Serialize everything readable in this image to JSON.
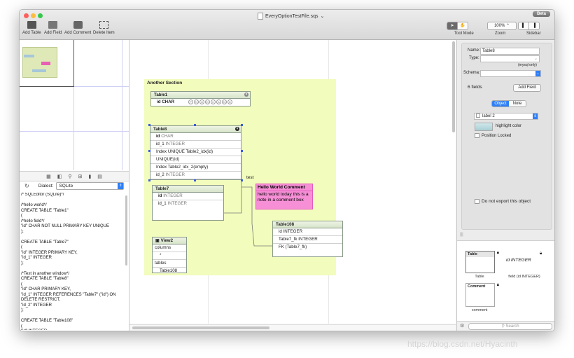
{
  "window": {
    "title": "EveryOptionTestFile.sqs",
    "beta_badge": "Beta"
  },
  "toolbar": {
    "add_table": "Add Table",
    "add_field": "Add Field",
    "add_comment": "Add Comment",
    "delete_item": "Delete Item",
    "tool_mode_label": "Tool Mode",
    "zoom_value": "100%",
    "zoom_label": "Zoom",
    "sidebar_label": "Sidebar"
  },
  "left_panel": {
    "dialect_label": "Dialect:",
    "dialect_value": "SQLite",
    "sql_text": "/* SQLEditor (SQLite)*/\n\n/*hello world*/\nCREATE TABLE \"Table1\"\n(\n/*hello field*/\n\"id\" CHAR NOT NULL PRIMARY KEY UNIQUE\n);\n\nCREATE TABLE \"Table7\"\n(\n\"id\" INTEGER PRIMARY KEY,\n\"id_1\" INTEGER\n);\n\n/*Text in another window*/\nCREATE TABLE \"Table8\"\n(\n\"id\" CHAR PRIMARY KEY,\n\"id_1\" INTEGER REFERENCES \"Table7\" (\"id\") ON\nDELETE RESTRICT,\n\"id_2\" INTEGER\n);\n\nCREATE TABLE \"Table108\"\n(\n\"id\" INTEGER,"
  },
  "canvas": {
    "section_title": "Another Section",
    "table1": {
      "name": "Table1",
      "rows": [
        "id CHAR"
      ],
      "badges": [
        "P",
        "N",
        "U",
        "D",
        "C",
        "A",
        "N",
        "D"
      ]
    },
    "table8": {
      "name": "Table8",
      "rows": [
        {
          "bold": "id",
          "type": "CHAR"
        },
        {
          "bold": "id_1",
          "type": "INTEGER"
        },
        {
          "bold": "",
          "type": "Index UNIQUE Table2_idx(id)"
        },
        {
          "bold": "",
          "type": "UNIQUE(id)"
        },
        {
          "bold": "",
          "type": "Index Table2_idx_2(empty)"
        },
        {
          "bold": "id_2",
          "type": "INTEGER"
        }
      ]
    },
    "table7": {
      "name": "Table7",
      "rows": [
        {
          "bold": "id",
          "type": "INTEGER"
        },
        {
          "bold": "id_1",
          "type": "INTEGER"
        }
      ]
    },
    "table108": {
      "name": "Table108",
      "rows": [
        "id INTEGER",
        "Table7_fk INTEGER",
        "FK (Table7_fk)"
      ]
    },
    "relation_label": "test",
    "note": {
      "title": "Hello World Comment",
      "body": "hello world  today this is a note in a comment box"
    },
    "view2": {
      "name": "View2",
      "rows": [
        "columns",
        "*",
        "tables",
        "Table108"
      ]
    }
  },
  "inspector": {
    "name_label": "Name:",
    "name_value": "Table8",
    "type_label": "Type:",
    "mysql_only": "(mysql only)",
    "schema_label": "Schema:",
    "fields_count": "6 fields",
    "add_field_button": "Add Field",
    "tab_object": "Object",
    "tab_note": "Note",
    "label_value": "label 2",
    "highlight_color": "highlight color",
    "position_locked": "Position Locked",
    "do_not_export": "Do not export this object"
  },
  "library": {
    "table_tile": "Table",
    "table_caption": "Table",
    "field_tile": "id INTEGER",
    "field_caption": "field (id INTEGER)",
    "comment_tile": "Comment",
    "comment_caption": "comment",
    "search_placeholder": "Search"
  },
  "watermark": "https://blog.csdn.net/Hyacinth"
}
